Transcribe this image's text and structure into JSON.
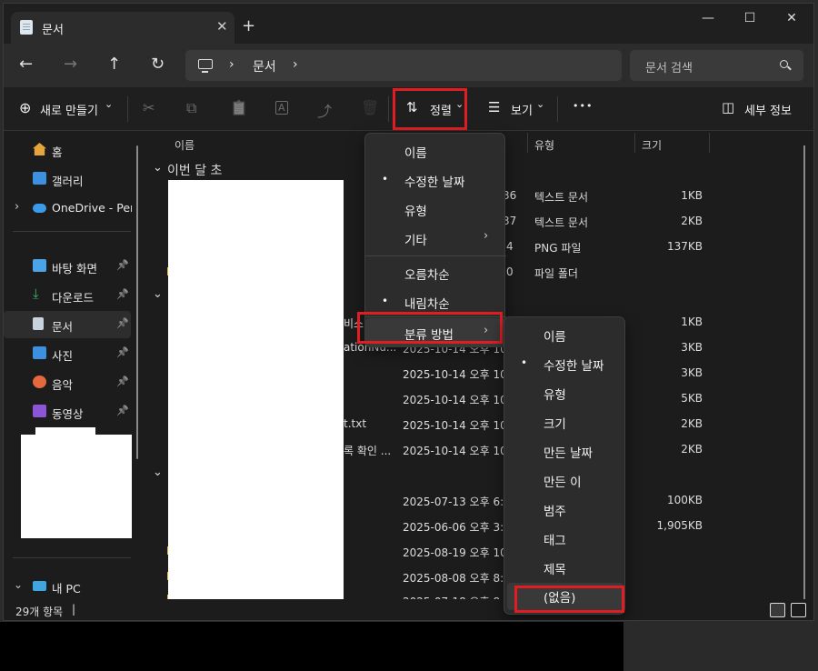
{
  "window": {
    "tab_title": "문서",
    "tab_close": "✕",
    "new_tab": "+",
    "minimize": "—",
    "maximize": "☐",
    "close": "✕"
  },
  "nav": {
    "back": "←",
    "forward": "→",
    "up": "↑",
    "refresh": "↻",
    "breadcrumb_sep": "›",
    "location": "문서",
    "search_placeholder": "문서 검색"
  },
  "command_bar": {
    "new_label": "새로 만들기",
    "new_chevron": "⌄",
    "sort_label": "정렬",
    "sort_icon": "⇅",
    "sort_chevron": "⌄",
    "view_label": "보기",
    "view_icon": "☰",
    "view_chevron": "⌄",
    "more": "•••",
    "details_label": "세부 정보",
    "details_icon": "◫",
    "cut_icon": "✂",
    "copy_icon": "⧉",
    "paste_icon": "📋",
    "rename_icon": "A",
    "share_icon": "⤴",
    "delete_icon": "🗑"
  },
  "sidebar": {
    "items": [
      {
        "label": "홈",
        "icon": "home-icon",
        "color": "#e7a33c"
      },
      {
        "label": "갤러리",
        "icon": "gallery-icon",
        "color": "#3d8fe0"
      },
      {
        "label": "OneDrive - Pers",
        "icon": "cloud-icon",
        "color": "#3c9be8",
        "expand": "›"
      },
      {
        "label": "바탕 화면",
        "icon": "desktop-icon",
        "color": "#4aa3e6",
        "pin": "📌"
      },
      {
        "label": "다운로드",
        "icon": "download-icon",
        "color": "#38b56a",
        "pin": "📌"
      },
      {
        "label": "문서",
        "icon": "document-icon",
        "color": "#c9d3de",
        "pin": "📌",
        "selected": true
      },
      {
        "label": "사진",
        "icon": "pictures-icon",
        "color": "#3d8fe0",
        "pin": "📌"
      },
      {
        "label": "음악",
        "icon": "music-icon",
        "color": "#e5693c",
        "pin": "📌"
      },
      {
        "label": "동영상",
        "icon": "video-icon",
        "color": "#8b55d6",
        "pin": "📌"
      },
      {
        "label": "내 PC",
        "icon": "pc-icon",
        "color": "#3fa6e0",
        "expand": "⌄"
      }
    ]
  },
  "columns": {
    "name": "이름",
    "type": "유형",
    "size": "크기"
  },
  "groups": {
    "this_month": "이번 달 초",
    "chevron": "⌄"
  },
  "rows_group1": [
    {
      "date_frag": "36",
      "type": "텍스트 문서",
      "size": "1KB"
    },
    {
      "date_frag": "37",
      "type": "텍스트 문서",
      "size": "2KB"
    },
    {
      "date_frag": "4",
      "type": "PNG 파일",
      "size": "137KB"
    },
    {
      "date_frag": "0",
      "type": "파일 폴더",
      "size": ""
    }
  ],
  "rows_group2": [
    {
      "name_frag": "비스",
      "date": "",
      "size": "1KB"
    },
    {
      "name_frag": "ationNu...",
      "date": "2025-10-14 오후 10",
      "size": "3KB"
    },
    {
      "name_frag": "",
      "date": "2025-10-14 오후 10",
      "size": "3KB"
    },
    {
      "name_frag": "",
      "date": "2025-10-14 오후 10",
      "size": "5KB"
    },
    {
      "name_frag": "t.txt",
      "date": "2025-10-14 오후 10",
      "size": "2KB"
    },
    {
      "name_frag": "록 확인 ...",
      "date": "2025-10-14 오후 10",
      "size": "2KB"
    }
  ],
  "rows_group3": [
    {
      "date": "2025-07-13 오후 6:4",
      "size": "100KB"
    },
    {
      "date": "2025-06-06 오후 3:5",
      "size": "1,905KB"
    },
    {
      "date": "2025-08-19 오후 10",
      "size": ""
    },
    {
      "date": "2025-08-08 오후 8:5",
      "size": ""
    },
    {
      "date": "2025-07-18 오후 8:0",
      "size": ""
    }
  ],
  "sort_menu": {
    "items": [
      {
        "label": "이름",
        "bullet": ""
      },
      {
        "label": "수정한 날짜",
        "bullet": "•"
      },
      {
        "label": "유형",
        "bullet": ""
      },
      {
        "label": "기타",
        "bullet": "",
        "arrow": "›"
      },
      {
        "label": "오름차순",
        "bullet": ""
      },
      {
        "label": "내림차순",
        "bullet": "•"
      },
      {
        "label": "분류 방법",
        "bullet": "",
        "arrow": "›"
      }
    ]
  },
  "group_menu": {
    "items": [
      {
        "label": "이름",
        "bullet": ""
      },
      {
        "label": "수정한 날짜",
        "bullet": "•"
      },
      {
        "label": "유형",
        "bullet": ""
      },
      {
        "label": "크기",
        "bullet": ""
      },
      {
        "label": "만든 날짜",
        "bullet": ""
      },
      {
        "label": "만든 이",
        "bullet": ""
      },
      {
        "label": "범주",
        "bullet": ""
      },
      {
        "label": "태그",
        "bullet": ""
      },
      {
        "label": "제목",
        "bullet": ""
      },
      {
        "label": "(없음)",
        "bullet": ""
      }
    ]
  },
  "status": {
    "item_count": "29개 항목",
    "divider": "|"
  },
  "colors": {
    "highlight": "#e11d24",
    "window_bg": "#1c1c1c",
    "menu_bg": "#2c2c2c"
  }
}
